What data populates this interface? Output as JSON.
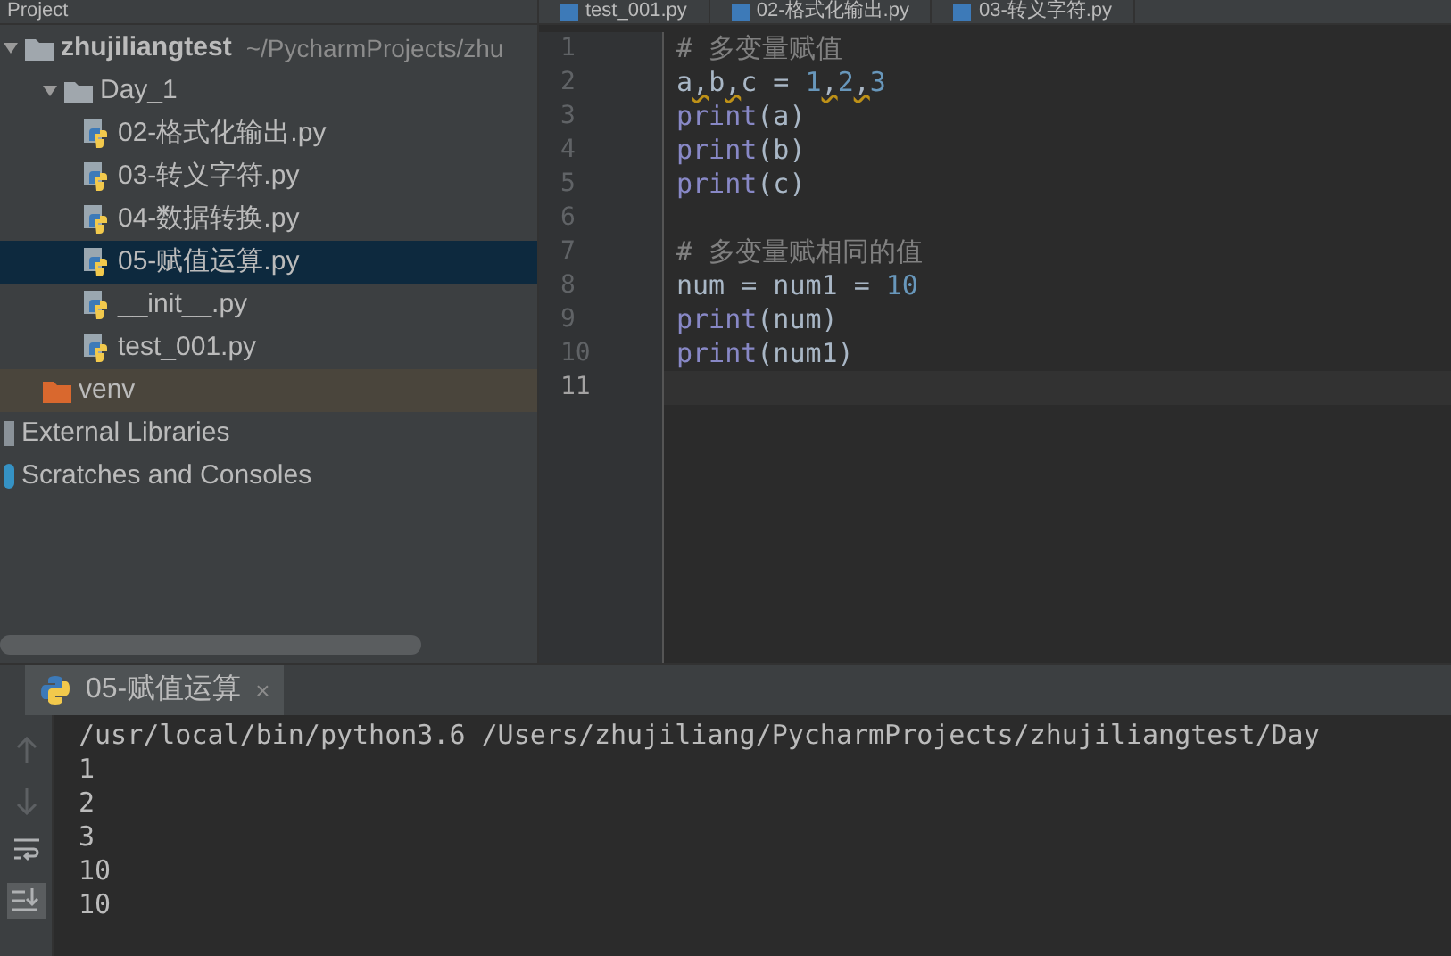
{
  "project_panel": {
    "title": "Project",
    "tree": [
      {
        "label": "zhujiliangtest",
        "path": "~/PycharmProjects/zhu",
        "kind": "project",
        "selected": false,
        "expanded": true,
        "children": [
          {
            "label": "Day_1",
            "kind": "folder",
            "selected": false,
            "expanded": true,
            "children": [
              {
                "label": "02-格式化输出.py",
                "kind": "python",
                "selected": false
              },
              {
                "label": "03-转义字符.py",
                "kind": "python",
                "selected": false
              },
              {
                "label": "04-数据转换.py",
                "kind": "python",
                "selected": false
              },
              {
                "label": "05-赋值运算.py",
                "kind": "python",
                "selected": true
              },
              {
                "label": "__init__.py",
                "kind": "python",
                "selected": false
              },
              {
                "label": "test_001.py",
                "kind": "python",
                "selected": false
              }
            ]
          },
          {
            "label": "venv",
            "kind": "excluded",
            "selected": false
          }
        ]
      },
      {
        "label": "External Libraries",
        "kind": "library",
        "selected": false
      },
      {
        "label": "Scratches and Consoles",
        "kind": "scratch",
        "selected": false
      }
    ]
  },
  "editor_tabs": [
    {
      "label": "test_001.py",
      "selected": false
    },
    {
      "label": "02-格式化输出.py",
      "selected": false
    },
    {
      "label": "03-转义字符.py",
      "selected": false
    }
  ],
  "editor": {
    "lines": [
      {
        "number": "1",
        "tokens": [
          {
            "text": "# 多变量赋值",
            "kind": "comment"
          }
        ]
      },
      {
        "number": "2",
        "tokens": [
          {
            "text": "a",
            "kind": "plain"
          },
          {
            "text": ",",
            "kind": "warning"
          },
          {
            "text": "b",
            "kind": "plain"
          },
          {
            "text": ",",
            "kind": "warning"
          },
          {
            "text": "c = ",
            "kind": "plain"
          },
          {
            "text": "1",
            "kind": "number"
          },
          {
            "text": ",",
            "kind": "warning"
          },
          {
            "text": "2",
            "kind": "number"
          },
          {
            "text": ",",
            "kind": "warning"
          },
          {
            "text": "3",
            "kind": "number"
          }
        ]
      },
      {
        "number": "3",
        "tokens": [
          {
            "text": "print",
            "kind": "builtin"
          },
          {
            "text": "(a)",
            "kind": "plain"
          }
        ]
      },
      {
        "number": "4",
        "tokens": [
          {
            "text": "print",
            "kind": "builtin"
          },
          {
            "text": "(b)",
            "kind": "plain"
          }
        ]
      },
      {
        "number": "5",
        "tokens": [
          {
            "text": "print",
            "kind": "builtin"
          },
          {
            "text": "(c)",
            "kind": "plain"
          }
        ]
      },
      {
        "number": "6"
      },
      {
        "number": "7",
        "tokens": [
          {
            "text": "# 多变量赋相同的值",
            "kind": "comment"
          }
        ]
      },
      {
        "number": "8",
        "tokens": [
          {
            "text": "num = num1 = ",
            "kind": "plain"
          },
          {
            "text": "10",
            "kind": "number"
          }
        ]
      },
      {
        "number": "9",
        "tokens": [
          {
            "text": "print",
            "kind": "builtin"
          },
          {
            "text": "(num)",
            "kind": "plain"
          }
        ]
      },
      {
        "number": "10",
        "tokens": [
          {
            "text": "print",
            "kind": "builtin"
          },
          {
            "text": "(num1)",
            "kind": "plain"
          }
        ]
      },
      {
        "number": "11",
        "current": true
      }
    ]
  },
  "run_panel": {
    "tab": {
      "label": "05-赋值运算",
      "close": "×"
    },
    "output": [
      "/usr/local/bin/python3.6 /Users/zhujiliang/PycharmProjects/zhujiliangtest/Day",
      "1",
      "2",
      "3",
      "10",
      "10"
    ]
  }
}
